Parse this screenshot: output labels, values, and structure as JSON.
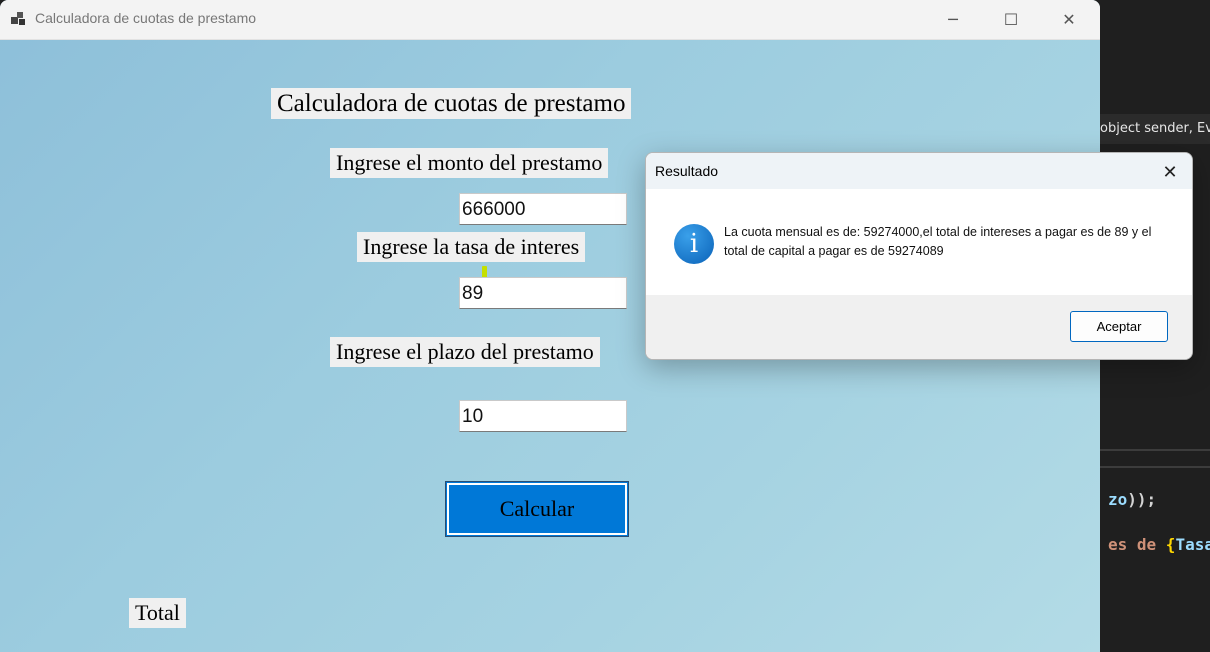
{
  "window": {
    "title": "Calculadora de cuotas de prestamo",
    "controls": {
      "minimize": "─",
      "maximize": "☐",
      "close": "✕"
    }
  },
  "form": {
    "heading": "Calculadora de cuotas de prestamo",
    "monto_label": "Ingrese el monto del prestamo",
    "monto_value": "666000",
    "tasa_label": "Ingrese la tasa de interes",
    "tasa_value": "89",
    "plazo_label": "Ingrese el plazo del prestamo",
    "plazo_value": "10",
    "calc_button": "Calcular",
    "total_label": "Total"
  },
  "dialog": {
    "title": "Resultado",
    "close": "✕",
    "icon": "info-icon",
    "icon_glyph": "i",
    "message": "La cuota mensual es de: 59274000,el total de intereses a pagar es de 89 y el total de capital a pagar es de 59274089",
    "ok_button": "Aceptar"
  },
  "editor": {
    "tooltip": "object sender, Eve",
    "line1": {
      "ident": "zo",
      "punct": "));"
    },
    "line2": {
      "keyword": " es de ",
      "brace": "{",
      "ident": "Tasa"
    }
  },
  "colors": {
    "accent": "#0078d7",
    "dialog_button_border": "#0067c0"
  }
}
